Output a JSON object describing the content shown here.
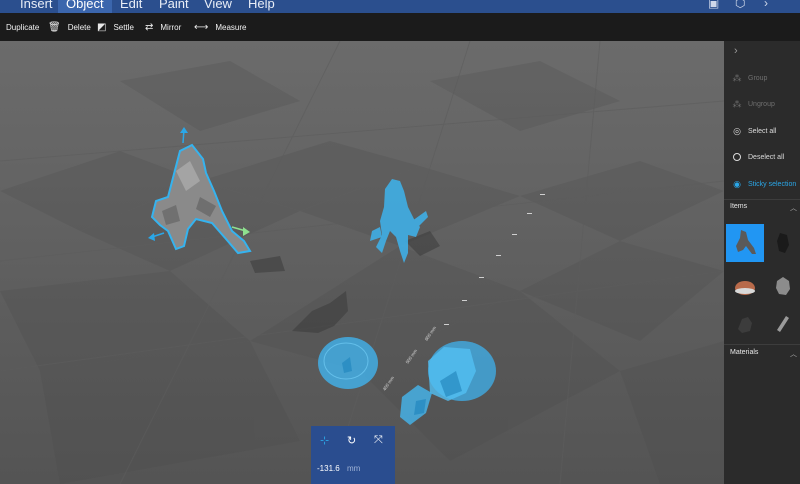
{
  "menu": {
    "tabs": [
      "Insert",
      "Object",
      "Edit",
      "Paint",
      "View",
      "Help"
    ],
    "active_tab": "Object"
  },
  "toolbar": {
    "duplicate": "Duplicate",
    "delete": "Delete",
    "settle": "Settle",
    "mirror": "Mirror",
    "measure": "Measure"
  },
  "panel": {
    "group": "Group",
    "ungroup": "Ungroup",
    "select_all": "Select all",
    "deselect_all": "Deselect all",
    "sticky_selection": "Sticky selection",
    "items_title": "Items",
    "materials_title": "Materials"
  },
  "transform": {
    "value": "-131.6",
    "unit": "mm"
  },
  "viewport": {
    "ruler_labels": [
      "600 mm",
      "500 mm",
      "400 mm"
    ]
  },
  "colors": {
    "menu_bg": "#2b4f8e",
    "accent": "#2aa7e8",
    "selected_thumb": "#2196f3",
    "transform_bg": "#2a4d8f"
  }
}
